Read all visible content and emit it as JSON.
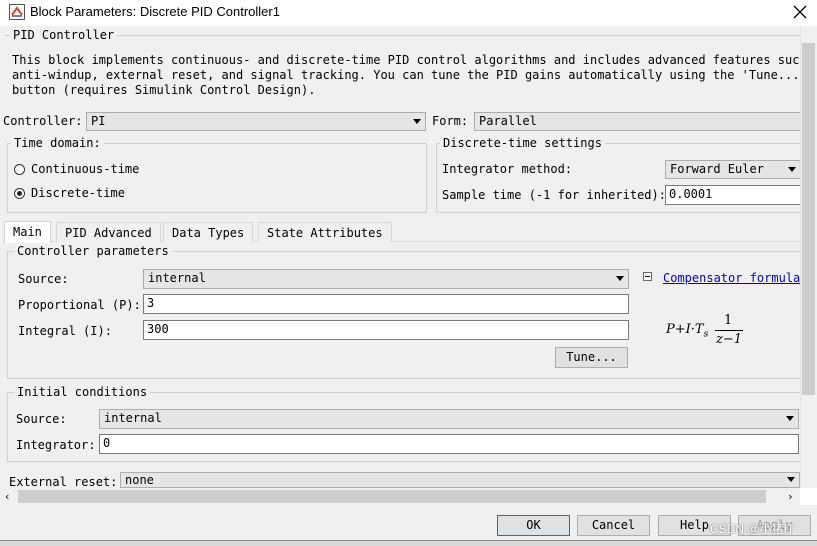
{
  "window": {
    "title": "Block Parameters: Discrete PID Controller1"
  },
  "header": {
    "group_title": "PID Controller",
    "description": [
      "This block implements continuous- and discrete-time PID control algorithms and includes advanced features such as",
      "anti-windup, external reset, and signal tracking. You can tune the PID gains automatically using the 'Tune...'",
      "button (requires Simulink Control Design)."
    ]
  },
  "controller": {
    "label": "Controller:",
    "value": "PI"
  },
  "form": {
    "label": "Form:",
    "value": "Parallel"
  },
  "time_domain": {
    "title": "Time domain:",
    "options": [
      "Continuous-time",
      "Discrete-time"
    ],
    "selected": "Discrete-time"
  },
  "discrete_settings": {
    "title": "Discrete-time settings",
    "integrator_method_label": "Integrator method:",
    "integrator_method_value": "Forward Euler",
    "sample_time_label": "Sample time (-1 for inherited):",
    "sample_time_value": "0.0001"
  },
  "tabs": [
    "Main",
    "PID Advanced",
    "Data Types",
    "State Attributes"
  ],
  "active_tab": "Main",
  "controller_parameters": {
    "title": "Controller parameters",
    "source_label": "Source:",
    "source_value": "internal",
    "proportional_label": "Proportional (P):",
    "proportional_value": "3",
    "integral_label": "Integral (I):",
    "integral_value": "300",
    "tune_label": "Tune...",
    "compensator_link": "Compensator formula",
    "formula": {
      "prefix": "P+I·T",
      "subscript": "s",
      "numerator": "1",
      "denominator": "z−1"
    }
  },
  "initial_conditions": {
    "title": "Initial conditions",
    "source_label": "Source:",
    "source_value": "internal",
    "integrator_label": "Integrator:",
    "integrator_value": "0"
  },
  "external_reset": {
    "label": "External reset:",
    "value": "none"
  },
  "buttons": {
    "ok": "OK",
    "cancel": "Cancel",
    "help": "Help",
    "apply": "Apply"
  },
  "watermark": "CSDN @小猪IT",
  "icons": [
    "app-icon",
    "close-icon",
    "dropdown-arrow-icon",
    "collapse-icon",
    "scroll-left-icon",
    "scroll-right-icon"
  ]
}
